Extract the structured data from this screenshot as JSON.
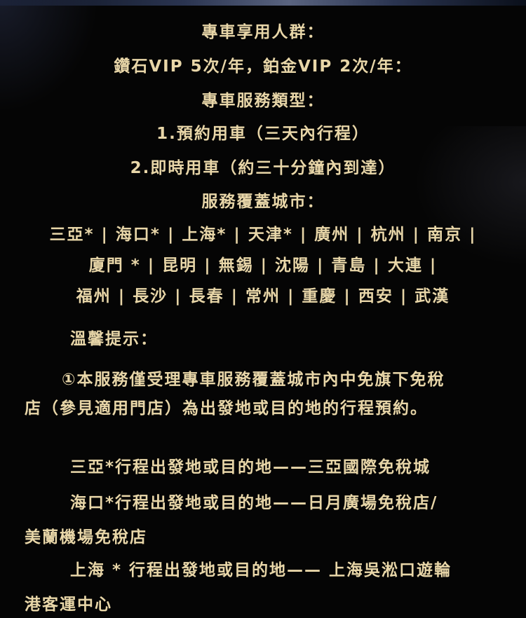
{
  "lines": {
    "eligible_title": "專車享用人群：",
    "eligible_detail": "鑽石VIP 5次/年，鉑金VIP 2次/年：",
    "service_type_title": "專車服務類型：",
    "type_1": "1.預約用車（三天內行程）",
    "type_2": "2.即時用車（約三十分鐘內到達）",
    "cities_title": "服務覆蓋城市：",
    "cities_row_1": "三亞* | 海口* | 上海* | 天津* | 廣州 | 杭州 | 南京 |",
    "cities_row_2": "廈門 * | 昆明 | 無錫 | 沈陽 | 青島 | 大連 |",
    "cities_row_3": "福州 | 長沙 | 長春 | 常州 | 重慶 | 西安 | 武漢",
    "tips_title": "溫馨提示：",
    "tip_1_line_1": "①本服務僅受理專車服務覆蓋城市內中免旗下免稅",
    "tip_1_line_2": "店（參見適用門店）為出發地或目的地的行程預約。",
    "sanya_note": "三亞*行程出發地或目的地——三亞國際免稅城",
    "haikou_note_line_1": "海口*行程出發地或目的地——日月廣場免稅店/",
    "haikou_note_line_2": "美蘭機場免稅店",
    "shanghai_note_line_1": "上海 * 行程出發地或目的地—— 上海吳淞口遊輪",
    "shanghai_note_line_2": "港客運中心"
  },
  "colors": {
    "background": "#050505",
    "text": "#e8d6a8"
  }
}
